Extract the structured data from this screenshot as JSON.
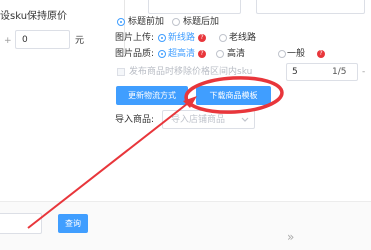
{
  "left_panel": {
    "sku_text": "设sku保持原价",
    "price_plus": "+",
    "price_value": "0",
    "price_unit": "元"
  },
  "title_position": {
    "option_prefix": "标题前加",
    "option_suffix": "标题后加",
    "selected": "标题前加"
  },
  "image_upload": {
    "label": "图片上传:",
    "option_new": "新线路",
    "option_old": "老线路",
    "selected": "新线路",
    "help": "?"
  },
  "image_quality": {
    "label": "图片品质:",
    "option_ultra": "超高清",
    "option_hd": "高清",
    "option_normal": "一般",
    "selected": "超高清",
    "help": "?"
  },
  "remove_sku": {
    "label": "发布商品时移除价格区间内sku",
    "value": "5",
    "ratio": "1/5",
    "dash": "-"
  },
  "actions": {
    "update_logistics": "更新物流方式",
    "download_template": "下载商品模板"
  },
  "import_goods": {
    "label": "导入商品:",
    "placeholder": "导入店铺商品"
  },
  "footer": {
    "query": "查询",
    "expand": "»"
  },
  "colors": {
    "accent": "#409eff",
    "annotation": "#e8363b",
    "help_badge": "#e8363b"
  }
}
